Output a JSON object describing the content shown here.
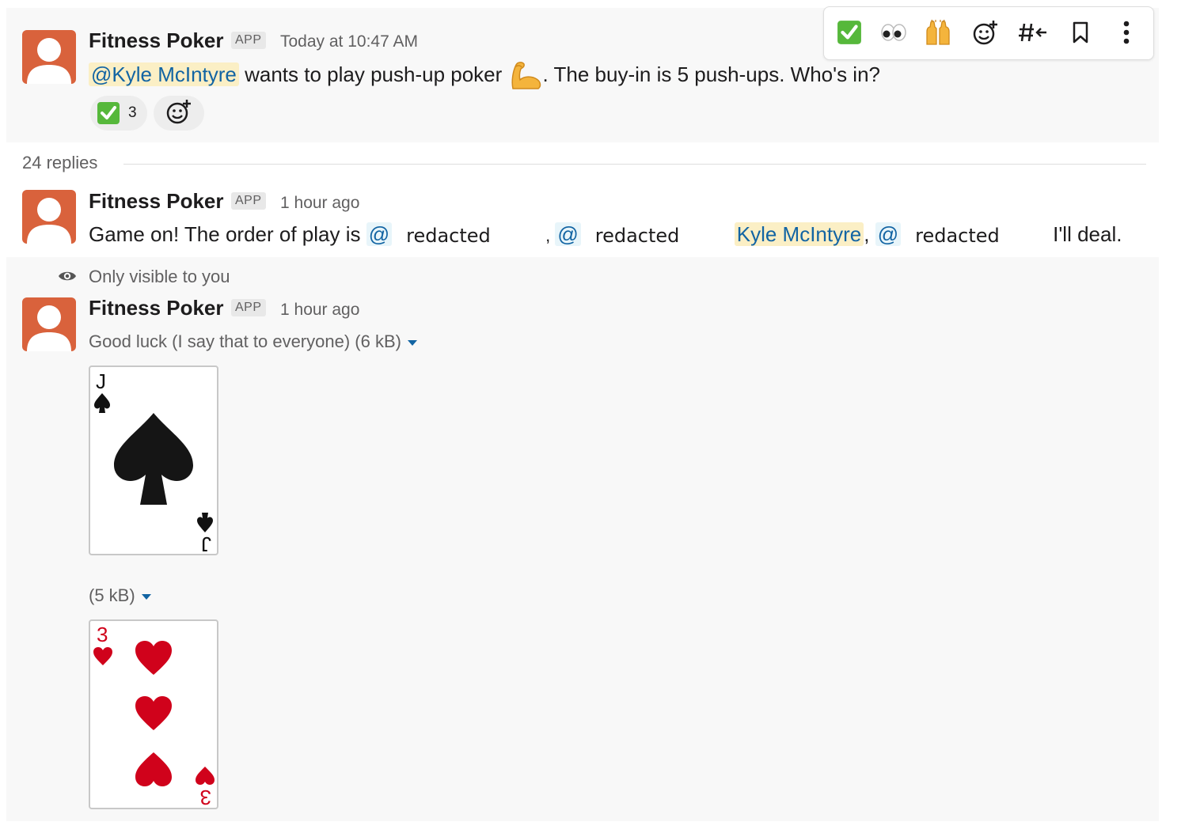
{
  "message1": {
    "author": "Fitness Poker",
    "badge": "APP",
    "timestamp": "Today at 10:47 AM",
    "mention": "@Kyle McIntyre",
    "text_before_emoji": " wants to play push-up poker ",
    "emoji": "flexed-biceps",
    "text_after_emoji": ". The buy-in is 5 push-ups. Who's in?",
    "reaction": {
      "emoji": "white-check-mark",
      "count": "3"
    }
  },
  "toolbar": {
    "icons": [
      "white-check-mark",
      "eyes",
      "raised-hands",
      "add-reaction",
      "share-to-channel",
      "bookmark",
      "more-actions"
    ]
  },
  "replies": {
    "count_label": "24 replies"
  },
  "message2": {
    "author": "Fitness Poker",
    "badge": "APP",
    "timestamp": "1 hour ago",
    "text_start": "Game on! The order of play is ",
    "at1": "@",
    "redacted1": "redacted",
    "comma1": ", ",
    "at2": "@",
    "redacted2": "redacted",
    "mention_kyle": "Kyle McIntyre",
    "comma2": ", ",
    "at3": "@",
    "redacted3": "redacted",
    "text_end": "I'll deal."
  },
  "ephemeral": {
    "notice": "Only visible to you"
  },
  "message3": {
    "author": "Fitness Poker",
    "badge": "APP",
    "timestamp": "1 hour ago",
    "file1_label": "Good luck (I say that to everyone) (6 kB)",
    "card1": {
      "rank": "J",
      "suit": "spades"
    },
    "file2_label": "(5 kB)",
    "card2": {
      "rank": "3",
      "suit": "hearts"
    }
  },
  "colors": {
    "avatar": "#d9623c",
    "mention_bg": "#fbefc5",
    "link": "#1264a3",
    "hearts": "#d0021b",
    "spades": "#111111"
  }
}
